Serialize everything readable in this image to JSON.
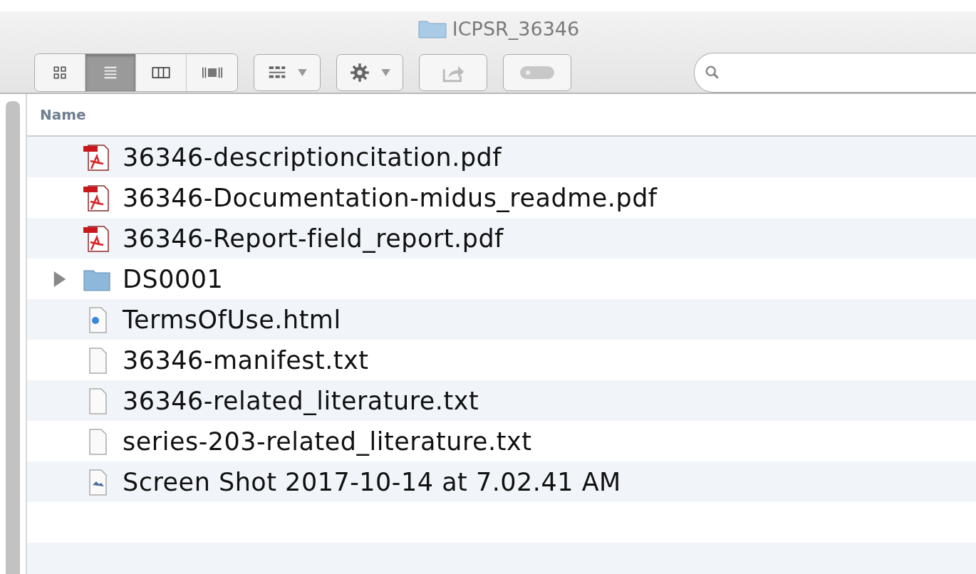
{
  "window": {
    "title": "ICPSR_36346"
  },
  "view_modes": [
    {
      "kind": "icon",
      "selected": false
    },
    {
      "kind": "list",
      "selected": true
    },
    {
      "kind": "column",
      "selected": false
    },
    {
      "kind": "coverflow",
      "selected": false
    }
  ],
  "table": {
    "columns": [
      "Name"
    ],
    "rows": [
      {
        "kind": "pdf",
        "name": "36346-descriptioncitation.pdf"
      },
      {
        "kind": "pdf",
        "name": "36346-Documentation-midus_readme.pdf"
      },
      {
        "kind": "pdf",
        "name": "36346-Report-field_report.pdf"
      },
      {
        "kind": "folder",
        "name": "DS0001",
        "expanded": false
      },
      {
        "kind": "html",
        "name": "TermsOfUse.html"
      },
      {
        "kind": "text",
        "name": "36346-manifest.txt"
      },
      {
        "kind": "text",
        "name": "36346-related_literature.txt"
      },
      {
        "kind": "text",
        "name": "series-203-related_literature.txt"
      },
      {
        "kind": "image",
        "name": "Screen Shot 2017-10-14 at 7.02.41 AM"
      }
    ]
  }
}
